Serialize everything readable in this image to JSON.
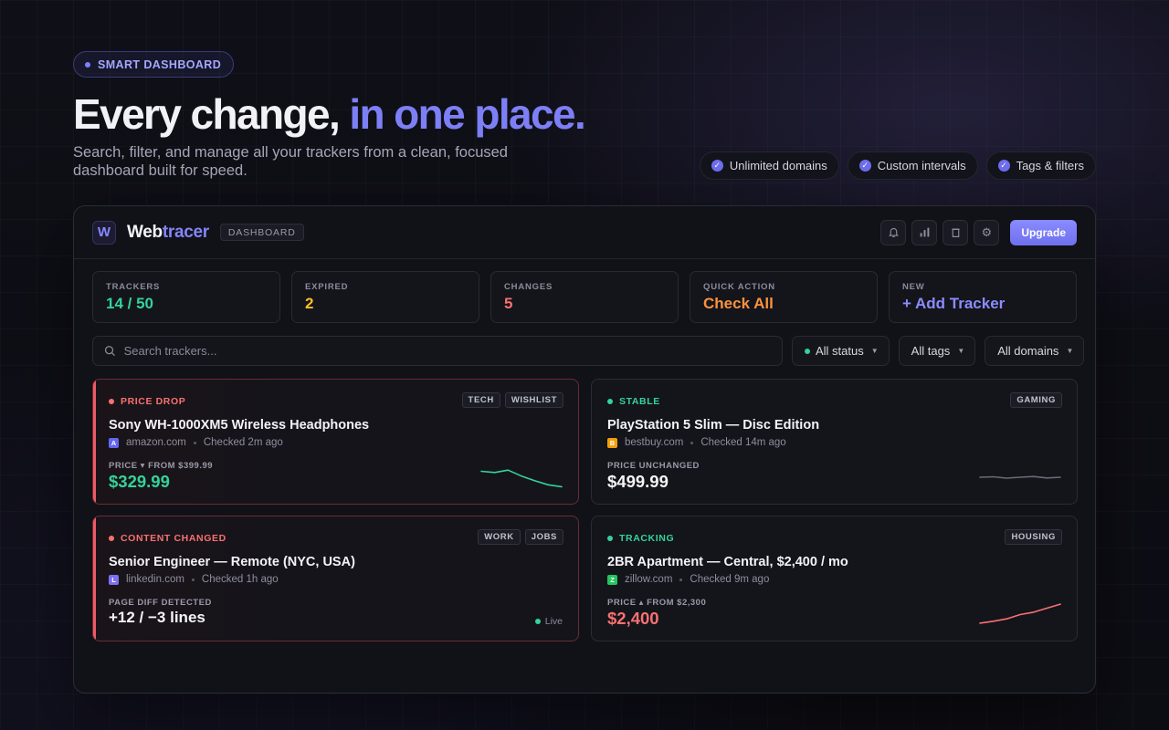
{
  "hero": {
    "eyebrow": "SMART DASHBOARD",
    "headline_main": "Every change, ",
    "headline_accent": "in one place.",
    "subhead": "Search, filter, and manage all your trackers from a clean, focused dashboard built for speed.",
    "features": [
      "Unlimited domains",
      "Custom intervals",
      "Tags & filters"
    ]
  },
  "app": {
    "logo_letter": "W",
    "brand_part1": "Web",
    "brand_part2": "tracer",
    "badge": "DASHBOARD",
    "upgrade_label": "Upgrade",
    "icons": [
      "bell-icon",
      "bar-chart-icon",
      "trash-icon",
      "gear-icon"
    ]
  },
  "stats": [
    {
      "label": "TRACKERS",
      "value": "14 / 50",
      "color": "#34d399"
    },
    {
      "label": "EXPIRED",
      "value": "2",
      "color": "#fbbf24"
    },
    {
      "label": "CHANGES",
      "value": "5",
      "color": "#f87171"
    },
    {
      "label": "QUICK ACTION",
      "value": "Check All",
      "color": "#fb923c"
    },
    {
      "label": "NEW",
      "value": "+ Add Tracker",
      "color": "#8b8cff"
    }
  ],
  "filters": {
    "search_placeholder": "Search trackers...",
    "status": "All status",
    "tags": "All tags",
    "domains": "All domains"
  },
  "cards": [
    {
      "status": "PRICE DROP",
      "status_color": "#f87171",
      "alert": true,
      "tags": [
        "TECH",
        "WISHLIST"
      ],
      "title": "Sony WH-1000XM5 Wireless Headphones",
      "favicon": "A",
      "favicon_color": "#6366f1",
      "domain": "amazon.com",
      "checked": "Checked 2m ago",
      "price_label": "PRICE ▾ FROM $399.99",
      "price": "$329.99",
      "price_color": "#34d399",
      "spark_color": "#34d399",
      "trend": [
        0.75,
        0.7,
        0.8,
        0.55,
        0.35,
        0.18,
        0.1
      ]
    },
    {
      "status": "STABLE",
      "status_color": "#34d399",
      "alert": false,
      "tags": [
        "GAMING"
      ],
      "title": "PlayStation 5 Slim — Disc Edition",
      "favicon": "B",
      "favicon_color": "#f59e0b",
      "domain": "bestbuy.com",
      "checked": "Checked 14m ago",
      "price_label": "PRICE UNCHANGED",
      "price": "$499.99",
      "price_color": "#f5f5f7",
      "spark_color": "#6b6b78",
      "trend": [
        0.5,
        0.52,
        0.46,
        0.5,
        0.53,
        0.47,
        0.5
      ]
    },
    {
      "status": "CONTENT CHANGED",
      "status_color": "#f87171",
      "alert": true,
      "tags": [
        "WORK",
        "JOBS"
      ],
      "title": "Senior Engineer — Remote (NYC, USA)",
      "favicon": "L",
      "favicon_color": "#7c6ff0",
      "domain": "linkedin.com",
      "checked": "Checked 1h ago",
      "price_label": "PAGE DIFF DETECTED",
      "price": "+12 / −3 lines",
      "price_color": "#f5f5f7",
      "live": "Live"
    },
    {
      "status": "TRACKING",
      "status_color": "#34d399",
      "alert": false,
      "tags": [
        "HOUSING"
      ],
      "title": "2BR Apartment — Central, $2,400 / mo",
      "favicon": "Z",
      "favicon_color": "#22c55e",
      "domain": "zillow.com",
      "checked": "Checked 9m ago",
      "price_label": "PRICE ▴ FROM $2,300",
      "price": "$2,400",
      "price_color": "#f87171",
      "spark_color": "#f87171",
      "trend": [
        0.12,
        0.2,
        0.3,
        0.48,
        0.58,
        0.75,
        0.92
      ]
    }
  ]
}
